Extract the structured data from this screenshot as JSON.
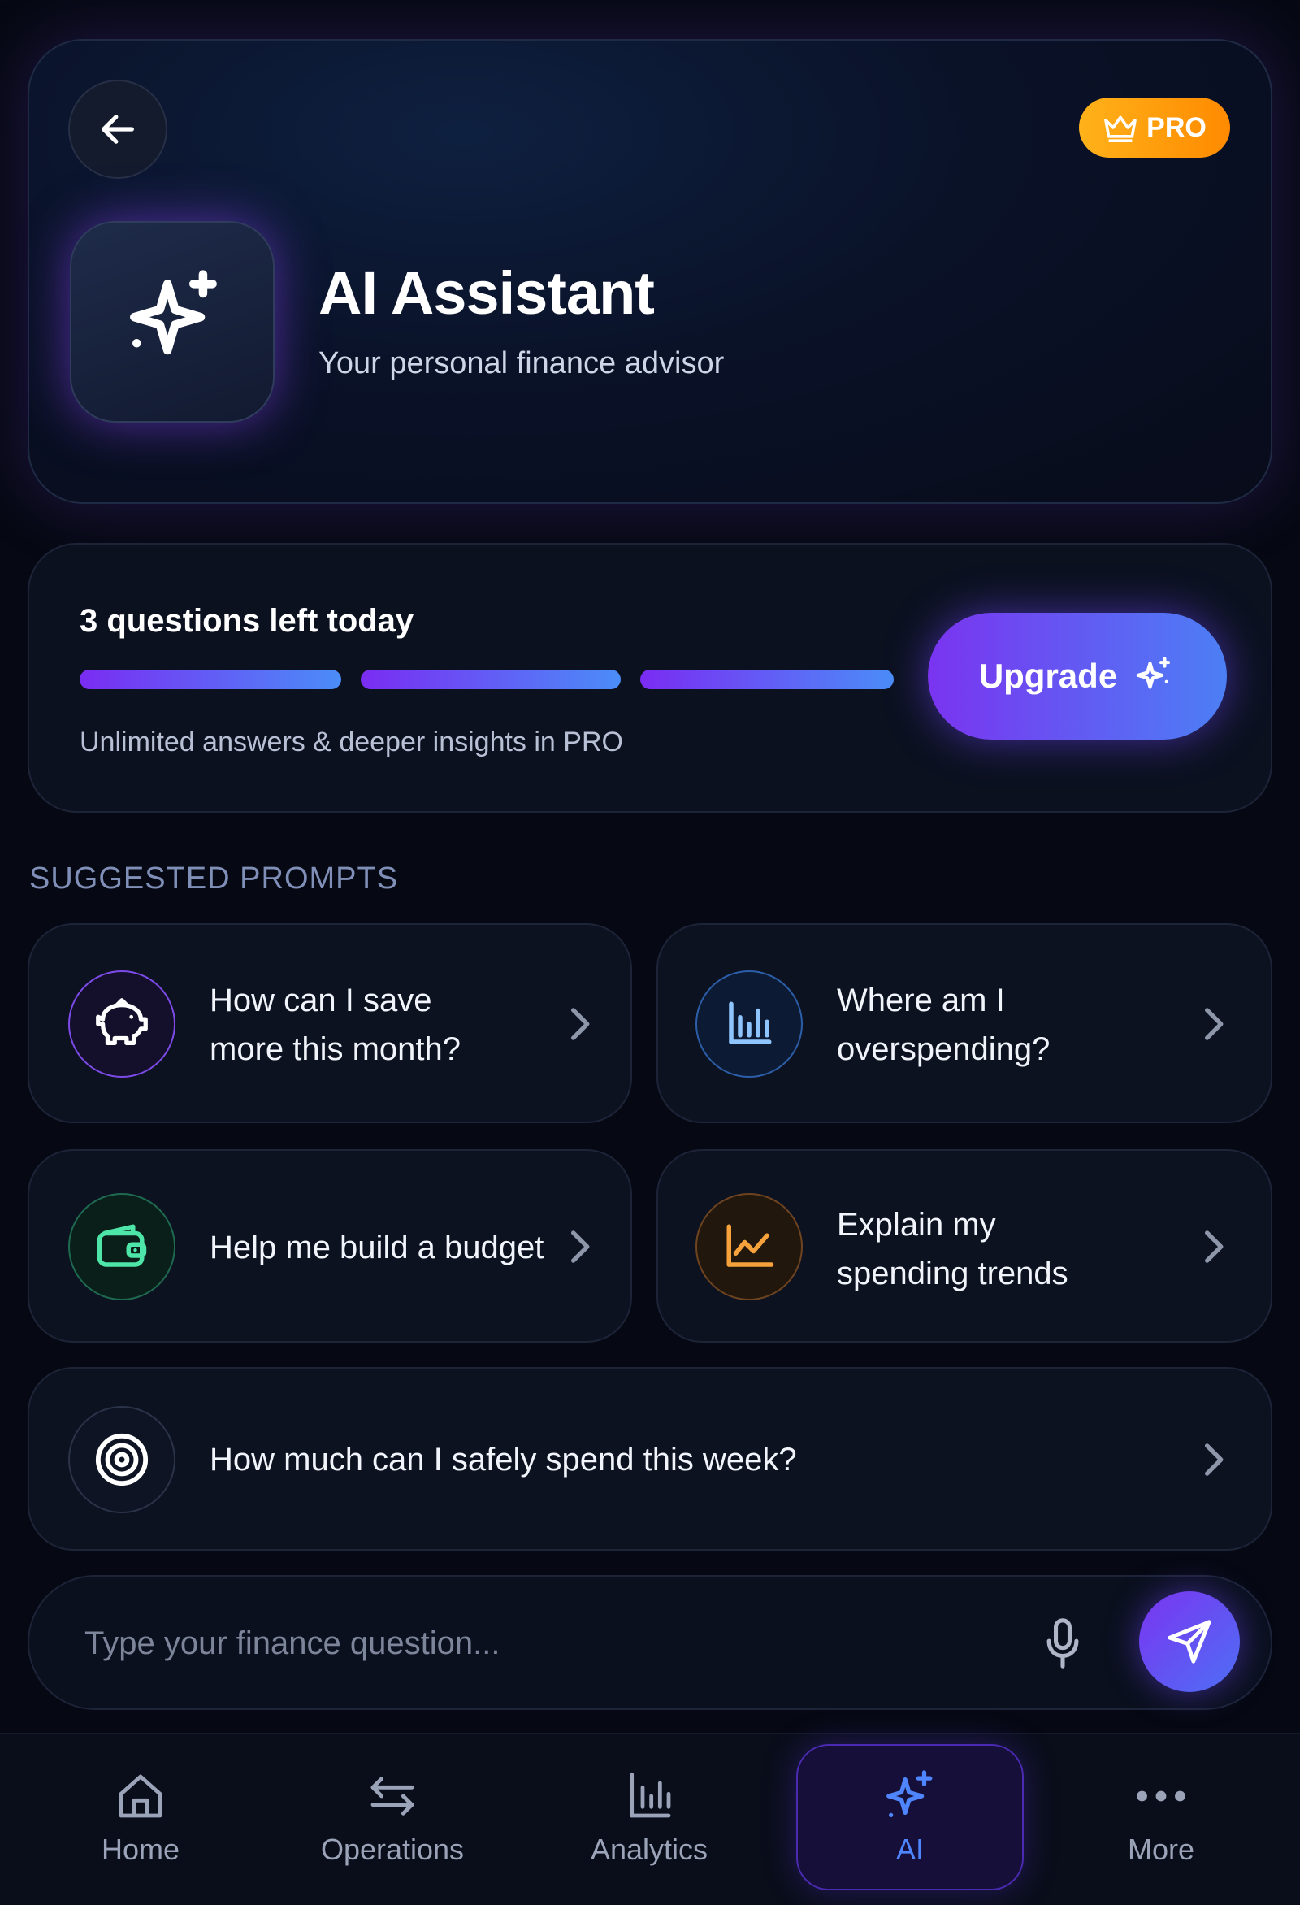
{
  "header": {
    "title": "AI Assistant",
    "subtitle": "Your personal finance advisor",
    "pro_badge": "PRO",
    "back_icon": "arrow-left-icon",
    "assistant_icon": "sparkles-icon"
  },
  "quota": {
    "title": "3 questions left today",
    "remaining": 3,
    "total": 3,
    "note": "Unlimited answers & deeper insights in PRO",
    "upgrade_label": "Upgrade"
  },
  "suggested": {
    "section_label": "SUGGESTED PROMPTS",
    "prompts": [
      {
        "line1": "How can I save",
        "line2": "more this month?",
        "icon": "piggy-bank-icon",
        "color": "#8b5cf6"
      },
      {
        "line1": "Where am I",
        "line2": "overspending?",
        "icon": "bar-chart-icon",
        "color": "#60a5fa"
      },
      {
        "line1": "Help me build a budget",
        "line2": "",
        "icon": "wallet-icon",
        "color": "#34d399"
      },
      {
        "line1": "Explain my",
        "line2": "spending trends",
        "icon": "trend-chart-icon",
        "color": "#f59e0b"
      },
      {
        "line1": "How much can I safely spend this week?",
        "line2": "",
        "icon": "target-icon",
        "color": "#ffffff"
      }
    ]
  },
  "input": {
    "placeholder": "Type your finance question...",
    "value": ""
  },
  "nav": {
    "items": [
      {
        "label": "Home",
        "icon": "home-icon",
        "active": false
      },
      {
        "label": "Operations",
        "icon": "transfer-arrows-icon",
        "active": false
      },
      {
        "label": "Analytics",
        "icon": "bar-chart-icon",
        "active": false
      },
      {
        "label": "AI",
        "icon": "sparkles-icon",
        "active": true
      },
      {
        "label": "More",
        "icon": "more-dots-icon",
        "active": false
      }
    ]
  },
  "colors": {
    "background": "#060913",
    "accent_purple": "#7a34f0",
    "accent_blue": "#4c7ff5",
    "pro_orange": "#ff9d0a",
    "active_nav": "#4f86ff"
  }
}
